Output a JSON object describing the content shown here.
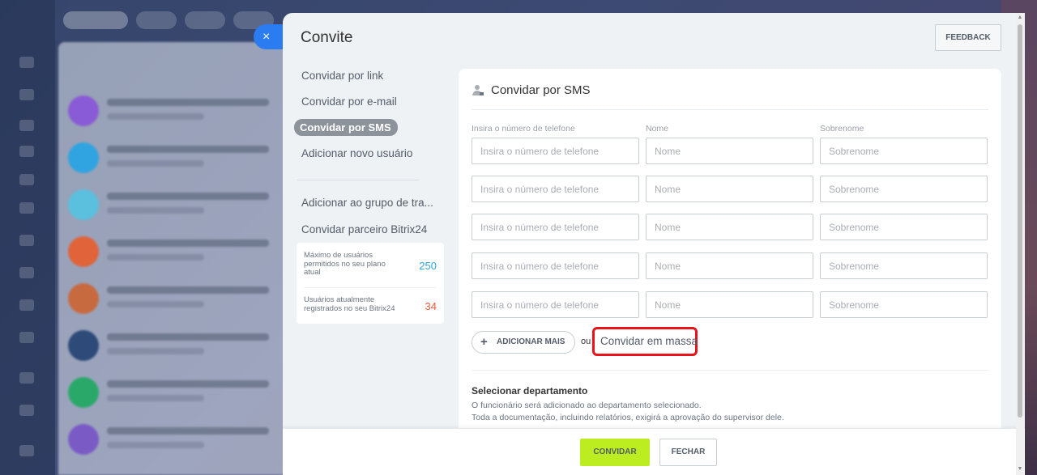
{
  "colors": {
    "accent_blue": "#2a7cf0",
    "invite_green": "#bbed21",
    "highlight_red": "#e8141a",
    "max_users_color": "#2fa4e0",
    "current_users_color": "#f15a3a"
  },
  "close_icon": "×",
  "panel": {
    "title": "Convite",
    "feedback_label": "FEEDBACK"
  },
  "menu": {
    "items": [
      {
        "label": "Convidar por link"
      },
      {
        "label": "Convidar por e-mail"
      },
      {
        "label": "Convidar por SMS"
      },
      {
        "label": "Adicionar novo usuário"
      },
      {
        "label": "Adicionar ao grupo de tra..."
      },
      {
        "label": "Convidar parceiro Bitrix24"
      }
    ],
    "active_index": 2
  },
  "limits": {
    "max": {
      "label": "Máximo de usuários permitidos no seu plano atual",
      "value": "250"
    },
    "current": {
      "label": "Usuários atualmente registrados no seu Bitrix24",
      "value": "34"
    }
  },
  "form": {
    "heading": "Convidar por SMS",
    "columns": {
      "phone": "Insira o número de telefone",
      "name": "Nome",
      "surname": "Sobrenome"
    },
    "placeholders": {
      "phone": "Insira o número de telefone",
      "name": "Nome",
      "surname": "Sobrenome"
    },
    "add_more_label": "ADICIONAR MAIS",
    "or_label": "ou",
    "mass_invite_label": "Convidar em massa",
    "department": {
      "title": "Selecionar departamento",
      "desc_line1": "O funcionário será adicionado ao departamento selecionado.",
      "desc_line2": "Toda a documentação, incluindo relatórios, exigirá a aprovação do supervisor dele."
    }
  },
  "footer": {
    "invite_label": "CONVIDAR",
    "close_label": "FECHAR"
  }
}
